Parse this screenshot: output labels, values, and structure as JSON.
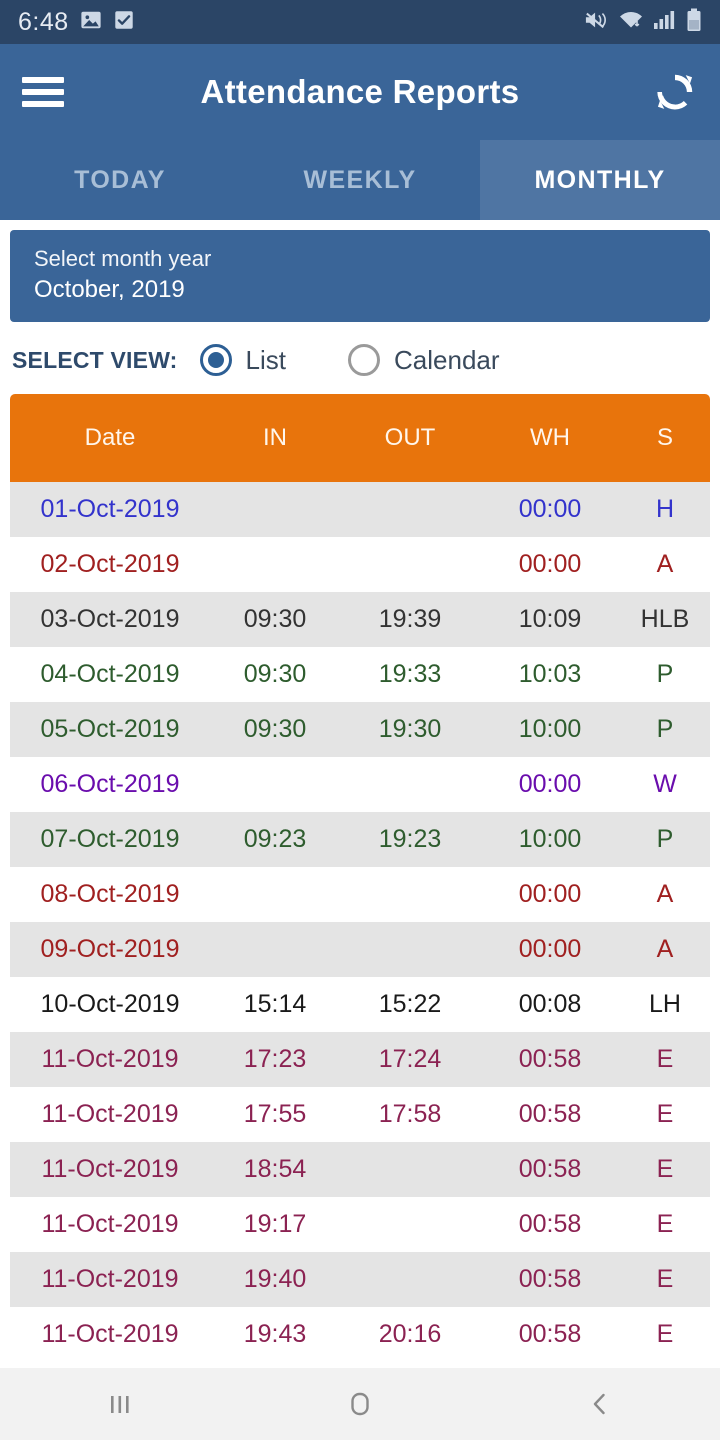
{
  "status_bar": {
    "time": "6:48",
    "left_icons": [
      "image-icon",
      "checkbox-icon"
    ],
    "right_icons": [
      "mute-vibrate-icon",
      "wifi-icon",
      "signal-bars-icon",
      "battery-icon"
    ],
    "background_color": "#2b4566"
  },
  "app_bar": {
    "menu_icon": "hamburger-menu-icon",
    "title": "Attendance Reports",
    "refresh_icon": "refresh-sync-icon",
    "background_color": "#3a6598"
  },
  "tabs": [
    {
      "label": "TODAY",
      "active": false
    },
    {
      "label": "WEEKLY",
      "active": false
    },
    {
      "label": "MONTHLY",
      "active": true
    }
  ],
  "month_selector": {
    "label": "Select month year",
    "value": "October, 2019",
    "background_color": "#3a6598"
  },
  "select_view": {
    "label": "SELECT VIEW:",
    "options": [
      {
        "label": "List",
        "selected": true
      },
      {
        "label": "Calendar",
        "selected": false
      }
    ],
    "accent_color": "#2d5f94"
  },
  "table": {
    "header_color": "#e8740c",
    "columns": [
      "Date",
      "IN",
      "OUT",
      "WH",
      "S"
    ],
    "status_colors": {
      "H": "#3333cc",
      "A": "#a02020",
      "HLB": "#333333",
      "P": "#2e5c2e",
      "W": "#6a0dad",
      "LH": "#1a1a1a",
      "E": "#8b2252"
    },
    "rows": [
      {
        "date": "01-Oct-2019",
        "in": "",
        "out": "",
        "wh": "00:00",
        "s": "H",
        "color": "#3333cc"
      },
      {
        "date": "02-Oct-2019",
        "in": "",
        "out": "",
        "wh": "00:00",
        "s": "A",
        "color": "#a02020"
      },
      {
        "date": "03-Oct-2019",
        "in": "09:30",
        "out": "19:39",
        "wh": "10:09",
        "s": "HLB",
        "color": "#333333"
      },
      {
        "date": "04-Oct-2019",
        "in": "09:30",
        "out": "19:33",
        "wh": "10:03",
        "s": "P",
        "color": "#2e5c2e"
      },
      {
        "date": "05-Oct-2019",
        "in": "09:30",
        "out": "19:30",
        "wh": "10:00",
        "s": "P",
        "color": "#2e5c2e"
      },
      {
        "date": "06-Oct-2019",
        "in": "",
        "out": "",
        "wh": "00:00",
        "s": "W",
        "color": "#6a0dad"
      },
      {
        "date": "07-Oct-2019",
        "in": "09:23",
        "out": "19:23",
        "wh": "10:00",
        "s": "P",
        "color": "#2e5c2e"
      },
      {
        "date": "08-Oct-2019",
        "in": "",
        "out": "",
        "wh": "00:00",
        "s": "A",
        "color": "#a02020"
      },
      {
        "date": "09-Oct-2019",
        "in": "",
        "out": "",
        "wh": "00:00",
        "s": "A",
        "color": "#a02020"
      },
      {
        "date": "10-Oct-2019",
        "in": "15:14",
        "out": "15:22",
        "wh": "00:08",
        "s": "LH",
        "color": "#1a1a1a"
      },
      {
        "date": "11-Oct-2019",
        "in": "17:23",
        "out": "17:24",
        "wh": "00:58",
        "s": "E",
        "color": "#8b2252"
      },
      {
        "date": "11-Oct-2019",
        "in": "17:55",
        "out": "17:58",
        "wh": "00:58",
        "s": "E",
        "color": "#8b2252"
      },
      {
        "date": "11-Oct-2019",
        "in": "18:54",
        "out": "",
        "wh": "00:58",
        "s": "E",
        "color": "#8b2252"
      },
      {
        "date": "11-Oct-2019",
        "in": "19:17",
        "out": "",
        "wh": "00:58",
        "s": "E",
        "color": "#8b2252"
      },
      {
        "date": "11-Oct-2019",
        "in": "19:40",
        "out": "",
        "wh": "00:58",
        "s": "E",
        "color": "#8b2252"
      },
      {
        "date": "11-Oct-2019",
        "in": "19:43",
        "out": "20:16",
        "wh": "00:58",
        "s": "E",
        "color": "#8b2252"
      }
    ]
  },
  "nav_bar": {
    "buttons": [
      {
        "icon": "recents-icon"
      },
      {
        "icon": "home-icon"
      },
      {
        "icon": "back-icon"
      }
    ]
  }
}
